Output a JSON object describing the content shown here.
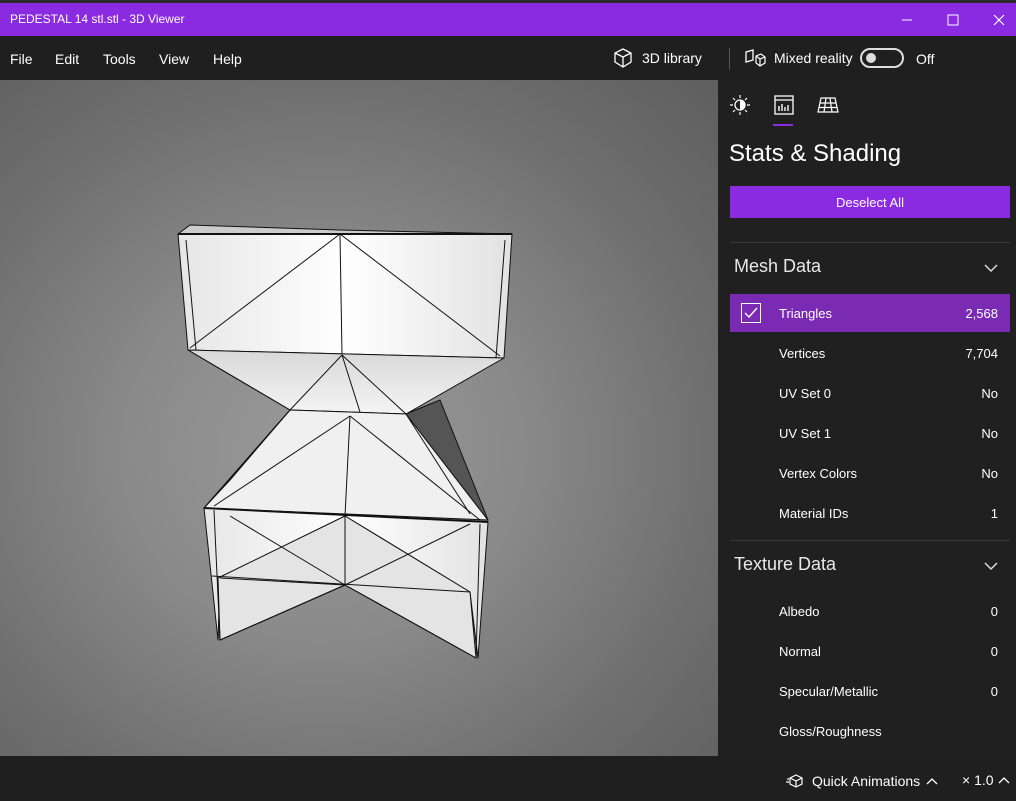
{
  "window": {
    "title": "PEDESTAL 14 stl.stl - 3D Viewer"
  },
  "menu": {
    "file": "File",
    "edit": "Edit",
    "tools": "Tools",
    "view": "View",
    "help": "Help"
  },
  "toolbar": {
    "library_label": "3D library",
    "mixed_reality_label": "Mixed reality",
    "toggle_state": "Off"
  },
  "panel": {
    "tabs": [
      "lighting-icon",
      "stats-icon",
      "grid-icon"
    ],
    "active_tab": "stats-icon",
    "title": "Stats & Shading",
    "deselect_label": "Deselect All",
    "mesh": {
      "title": "Mesh Data",
      "rows": [
        {
          "label": "Triangles",
          "value": "2,568",
          "checked": true
        },
        {
          "label": "Vertices",
          "value": "7,704"
        },
        {
          "label": "UV Set 0",
          "value": "No"
        },
        {
          "label": "UV Set 1",
          "value": "No"
        },
        {
          "label": "Vertex Colors",
          "value": "No"
        },
        {
          "label": "Material IDs",
          "value": "1"
        }
      ]
    },
    "texture": {
      "title": "Texture Data",
      "rows": [
        {
          "label": "Albedo",
          "value": "0"
        },
        {
          "label": "Normal",
          "value": "0"
        },
        {
          "label": "Specular/Metallic",
          "value": "0"
        },
        {
          "label": "Gloss/Roughness",
          "value": ""
        }
      ]
    }
  },
  "bottom": {
    "quick_animations": "Quick Animations",
    "speed": "× 1.0"
  },
  "colors": {
    "accent": "#8a2be2",
    "selected_row": "#7a2ab3",
    "panel_bg": "#202020"
  }
}
